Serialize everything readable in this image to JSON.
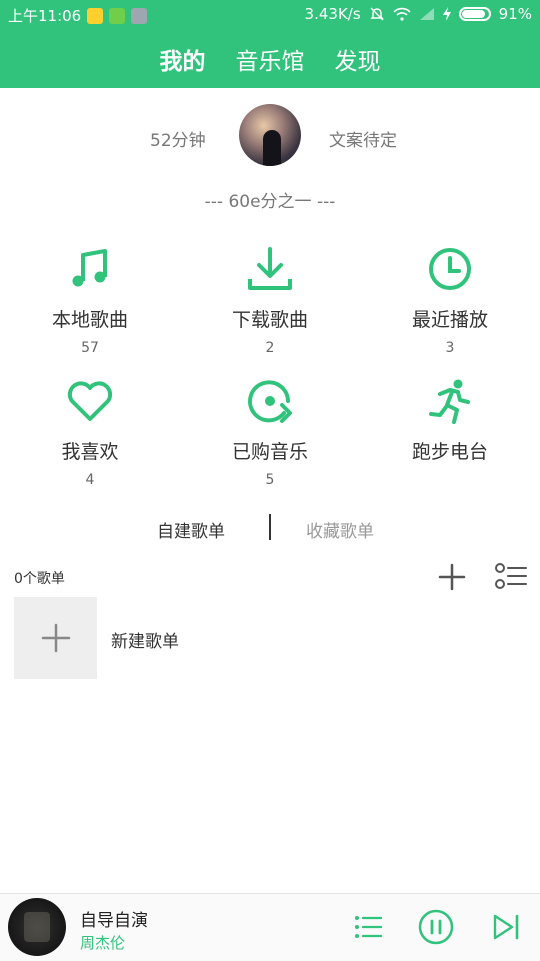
{
  "status": {
    "time": "上午11:06",
    "speed": "3.43K/s",
    "battery": "91%",
    "battery_level": 0.91,
    "app_icons": [
      "qq-icon",
      "wechat-icon",
      "notes-icon"
    ],
    "status_icons": [
      "mute-icon",
      "wifi-icon",
      "signal-icon",
      "charging-icon",
      "battery-icon"
    ]
  },
  "nav": {
    "tabs": [
      "我的",
      "音乐馆",
      "发现"
    ],
    "active": 0
  },
  "profile": {
    "minutes": "52分钟",
    "slogan": "文案待定",
    "subtitle": "---  60e分之一  ---"
  },
  "grid": [
    {
      "label": "本地歌曲",
      "count": "57",
      "icon": "music-note-icon"
    },
    {
      "label": "下载歌曲",
      "count": "2",
      "icon": "download-icon"
    },
    {
      "label": "最近播放",
      "count": "3",
      "icon": "clock-icon"
    },
    {
      "label": "我喜欢",
      "count": "4",
      "icon": "heart-icon"
    },
    {
      "label": "已购音乐",
      "count": "5",
      "icon": "purchased-disc-icon"
    },
    {
      "label": "跑步电台",
      "count": "",
      "icon": "running-icon"
    }
  ],
  "playlist_tabs": {
    "created": "自建歌单",
    "favorited": "收藏歌单"
  },
  "playlist": {
    "count_label": "0个歌单",
    "new_label": "新建歌单"
  },
  "player": {
    "title": "自导自演",
    "artist": "周杰伦"
  },
  "colors": {
    "accent": "#31c27c",
    "text": "#333333",
    "muted": "#999999"
  }
}
